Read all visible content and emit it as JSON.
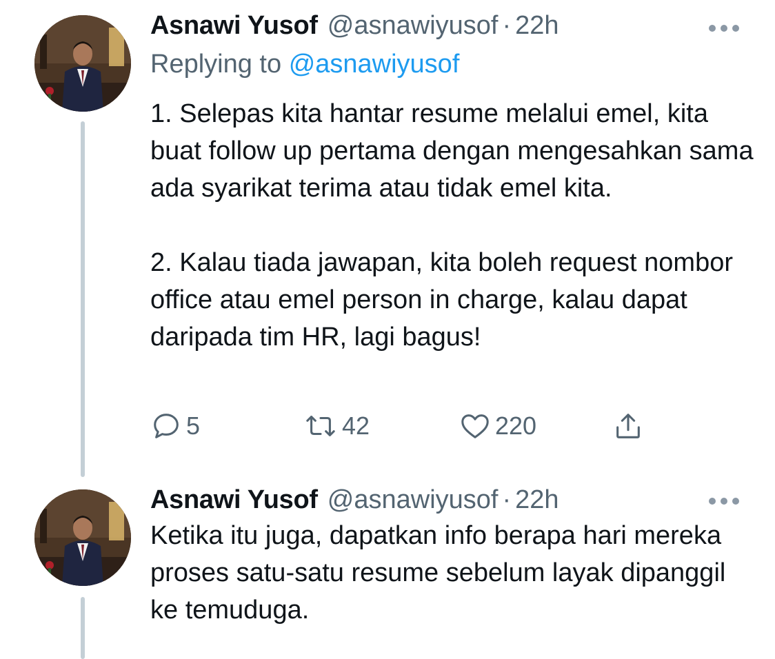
{
  "tweets": [
    {
      "author_name": "Asnawi Yusof",
      "handle": "@asnawiyusof",
      "separator": "·",
      "time": "22h",
      "replying_prefix": "Replying to",
      "replying_to": "@asnawiyusof",
      "paragraphs": [
        "1. Selepas kita hantar resume melalui emel, kita buat follow up pertama dengan mengesahkan sama ada syarikat terima atau tidak emel kita.",
        "2. Kalau tiada jawapan, kita boleh request nombor office atau emel person in charge, kalau dapat daripada tim HR, lagi bagus!"
      ],
      "actions": {
        "reply_icon": "reply-icon",
        "reply_count": "5",
        "retweet_icon": "retweet-icon",
        "retweet_count": "42",
        "like_icon": "heart-icon",
        "like_count": "220",
        "share_icon": "share-icon"
      },
      "more_icon": "more-options-icon"
    },
    {
      "author_name": "Asnawi Yusof",
      "handle": "@asnawiyusof",
      "separator": "·",
      "time": "22h",
      "paragraphs": [
        "Ketika itu juga, dapatkan info berapa hari mereka proses satu-satu resume sebelum layak dipanggil ke temuduga."
      ],
      "more_icon": "more-options-icon"
    }
  ],
  "colors": {
    "text_primary": "#0f1419",
    "text_secondary": "#536471",
    "link": "#1d9bf0",
    "thread_line": "#c4cfd6"
  }
}
